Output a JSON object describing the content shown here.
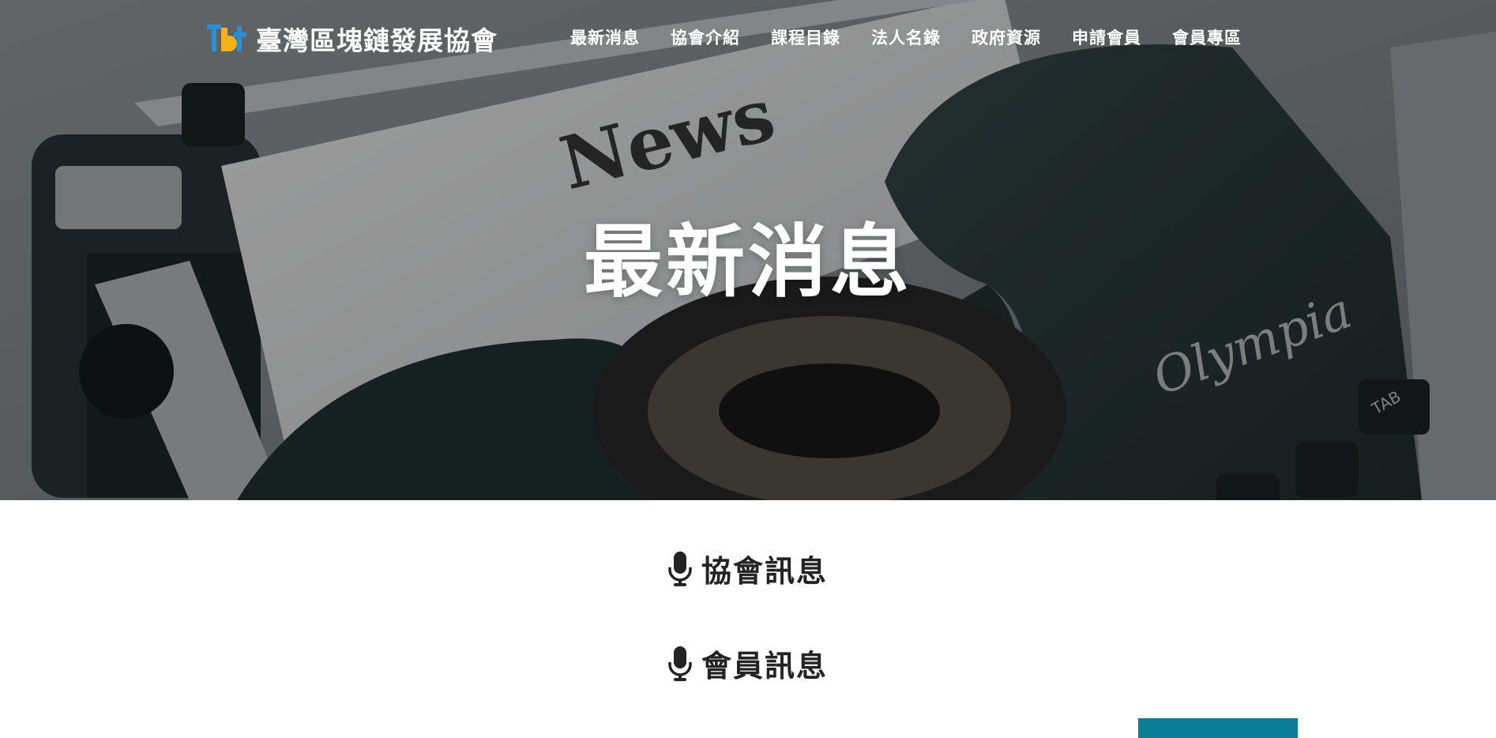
{
  "header": {
    "logo_icon": "tbt-logo-icon",
    "site_name": "臺灣區塊鏈發展協會",
    "nav": [
      {
        "label": "最新消息"
      },
      {
        "label": "協會介紹"
      },
      {
        "label": "課程目錄"
      },
      {
        "label": "法人名錄"
      },
      {
        "label": "政府資源"
      },
      {
        "label": "申請會員"
      },
      {
        "label": "會員專區"
      }
    ]
  },
  "hero": {
    "title": "最新消息",
    "background_text": "News",
    "typewriter_brand": "Olympia",
    "key_label": "TAB"
  },
  "sections": [
    {
      "icon": "microphone-icon",
      "title": "協會訊息"
    },
    {
      "icon": "microphone-icon",
      "title": "會員訊息"
    }
  ],
  "colors": {
    "accent": "#0c7d96",
    "heading_text": "#232323",
    "logo_blue": "#2a8fd6",
    "logo_yellow": "#f5b21b"
  }
}
